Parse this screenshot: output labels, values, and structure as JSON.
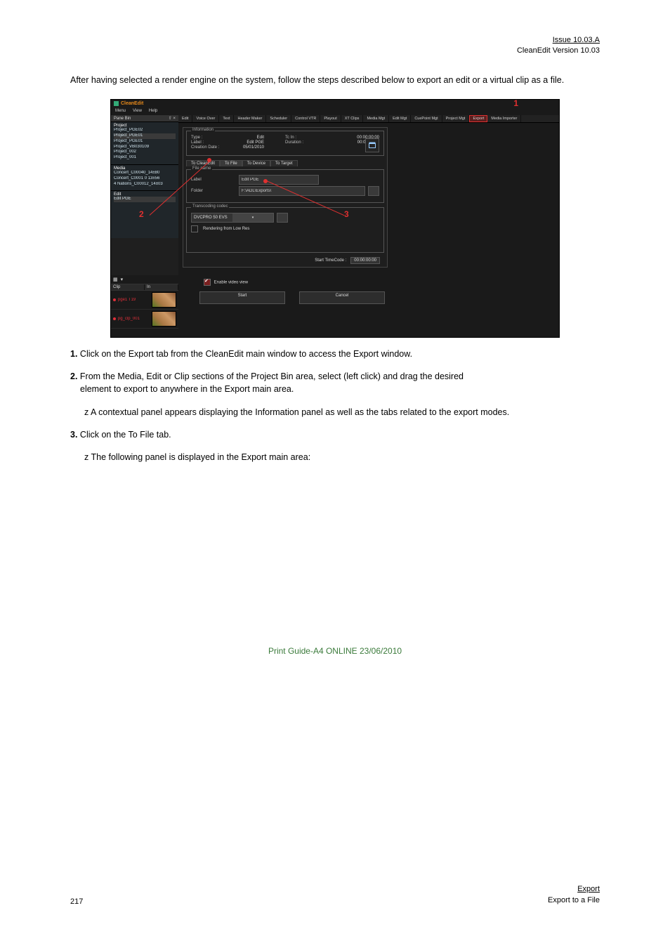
{
  "doc_header": {
    "issue": "Issue 10.03.A",
    "product": "CleanEdit  Version 10.03",
    "page_top_right": true
  },
  "intro": "After having selected a render engine on the system, follow the steps described below to export an edit or a virtual clip as a file.",
  "app": {
    "title": "CleanEdit",
    "menu": [
      "Menu",
      "View",
      "Help"
    ],
    "pane_header": {
      "label": "Pane Bin",
      "pin": "⇧ ×"
    },
    "sidebar": {
      "project": {
        "title": "Project",
        "items": [
          "Project_PGE02",
          "Project_PGE01",
          "Project_PGE01",
          "Project_VB030109",
          "Project_002",
          "Project_001"
        ]
      },
      "media": {
        "title": "Media",
        "items": [
          "Concert_C00040_14±80",
          "Concert_C0001 0  13±56",
          "4 Nations_C00012_14±03"
        ]
      },
      "edit": {
        "title": "Edit",
        "items": [
          "Edit PGE"
        ]
      }
    },
    "clips": {
      "cols": [
        "Clip",
        "In"
      ],
      "rows": [
        {
          "name": "pge1 T19"
        },
        {
          "name": "pg_clp_001"
        }
      ]
    },
    "tabs": [
      "Edit",
      "Voice Over",
      "Text",
      "Header Maker",
      "Scheduler",
      "Control VTR",
      "Playout",
      "XT Clips",
      "Media Mgt",
      "Edit Mgt",
      "CuePoint Mgt",
      "Project Mgt",
      "Export",
      "Media Importer"
    ],
    "active_tab": "Export",
    "info": {
      "legend": "Information",
      "type_label": "Type :",
      "type": "Edit",
      "label_label": "Label :",
      "label": "Edit PGE",
      "date_label": "Creation Date :",
      "date": "05/01/2010",
      "tcin_label": "Tc In :",
      "tcin": "00:00:00:00",
      "dur_label": "Duration :",
      "dur": "00:00:51:11"
    },
    "inner_tabs": [
      "To CleanEdit",
      "To File",
      "To Device",
      "To Target"
    ],
    "active_inner": "To File",
    "filename": {
      "legend": "File name",
      "label_label": "Label",
      "label_value": "Edit PGE",
      "folder_label": "Folder",
      "folder_value": "F:\\ADL\\Exports\\"
    },
    "transcode": {
      "legend": "Transcoding codec",
      "codec": "DVCPRO 50 EVS",
      "render_lr": "Rendering from Low Res"
    },
    "start_tc": {
      "label": "Start TimeCode :",
      "value": "00:00:00:00"
    },
    "enable_vv": "Enable video view",
    "buttons": {
      "start": "Start",
      "cancel": "Cancel"
    },
    "callouts": {
      "c1": "1",
      "c2": "2",
      "c3": "3"
    }
  },
  "undertext": {
    "n1": "1.",
    "p1": " Click on the Export tab from the CleanEdit main window to access the Export window.",
    "n2": "2.",
    "p2": " From the Media, Edit or Clip sections of the Project Bin area, select (left click) and drag the desired",
    "p2b": " element to export to anywhere in the Export main area.",
    "p2c": " z A contextual panel appears displaying the Information panel as well as the tabs related to the export modes.",
    "n3": "3.",
    "p3": " Click on the To File tab.",
    "p3b": " z The following panel is displayed in the Export main area:"
  },
  "printguide": "Print Guide-A4 ONLINE 23/06/2010",
  "footer_left": "217",
  "footer_right": {
    "line1": "Export",
    "line2": "Export to a File"
  }
}
